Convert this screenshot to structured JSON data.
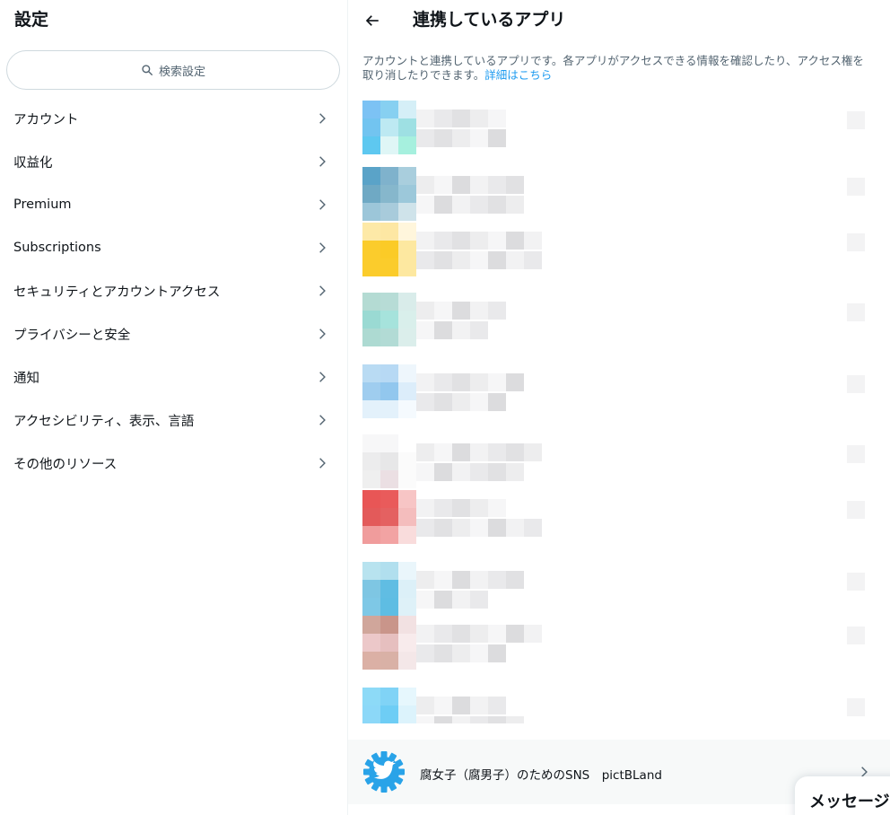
{
  "sidebar": {
    "title": "設定",
    "search_placeholder": "検索設定",
    "items": [
      {
        "label": "アカウント"
      },
      {
        "label": "収益化"
      },
      {
        "label": "Premium"
      },
      {
        "label": "Subscriptions"
      },
      {
        "label": "セキュリティとアカウントアクセス"
      },
      {
        "label": "プライバシーと安全"
      },
      {
        "label": "通知"
      },
      {
        "label": "アクセシビリティ、表示、言語"
      },
      {
        "label": "その他のリソース"
      }
    ]
  },
  "main": {
    "title": "連携しているアプリ",
    "description": "アカウントと連携しているアプリです。各アプリがアクセスできる情報を確認したり、アクセス権を取り消したりできます。",
    "details_link": "詳細はこちら",
    "apps": [
      {
        "name": "",
        "icon_colors": [
          "#7cc2f4",
          "#87d0f1",
          "#d5eff7",
          "#72c4f0",
          "#bde9f2",
          "#9ee0e3",
          "#5ec8f0",
          "#dff6f6",
          "#a6f0de"
        ]
      },
      {
        "name": "",
        "icon_colors": [
          "#5aa3c8",
          "#7fb2cc",
          "#a9cedd",
          "#6fa9c4",
          "#86b7cc",
          "#9cc8da",
          "#9cc6d9",
          "#a8cbdb",
          "#cfe3ea"
        ]
      },
      {
        "name": "",
        "icon_colors": [
          "#fde9a7",
          "#fde7a3",
          "#fff6dc",
          "#fbcc2c",
          "#fbcb27",
          "#fde8a0",
          "#fbcc2c",
          "#fbcc2b",
          "#fde8a0"
        ]
      },
      {
        "name": "",
        "icon_colors": [
          "#b4dbd3",
          "#b7dcd6",
          "#d9ecea",
          "#9adad3",
          "#a6e3dc",
          "#d9efeb",
          "#addad2",
          "#b2dbd5",
          "#dbeeeb"
        ]
      },
      {
        "name": "",
        "icon_colors": [
          "#b9dbf3",
          "#b7d9f4",
          "#eef6fc",
          "#9fcdef",
          "#92c7ee",
          "#dcedfa",
          "#e3f1fb",
          "#e3f1fb",
          "#f5fafe"
        ]
      },
      {
        "name": "",
        "icon_colors": [
          "#f7f7f8",
          "#f7f7f8",
          "#ffffff",
          "#ececed",
          "#e7e7e8",
          "#fbfbfb",
          "#efefef",
          "#ebdfe3",
          "#fbfbfb"
        ]
      },
      {
        "name": "",
        "icon_colors": [
          "#e85656",
          "#e95b5b",
          "#f7c5c5",
          "#e35a5a",
          "#e46161",
          "#f4bdbd",
          "#f09c9c",
          "#f2a3a3",
          "#f9dcdc"
        ]
      },
      {
        "name": "",
        "icon_colors": [
          "#b8e3ef",
          "#b1dfee",
          "#eaf6fb",
          "#7ec6e3",
          "#60bde3",
          "#dcf0f8",
          "#7ec8e6",
          "#5ebde3",
          "#def1f8"
        ]
      },
      {
        "name": "",
        "icon_colors": [
          "#d0a69b",
          "#c9958a",
          "#f2e1e2",
          "#ecc8c9",
          "#e6bfbf",
          "#f8ebec",
          "#dbb0a5",
          "#d9b1a6",
          "#f4e7e8"
        ]
      },
      {
        "name": "",
        "icon_colors": [
          "#8ddaf7",
          "#80d3f6",
          "#e6f7fd",
          "#8cd8f8",
          "#6ecdf5",
          "#dcf3fc",
          "#ffffff",
          "#e3f3fb",
          "#ffffff"
        ]
      }
    ],
    "featured_app": {
      "name": "腐女子（腐男子）のためのSNS　pictBLand"
    }
  },
  "messages_drawer": {
    "label": "メッセージ"
  },
  "colors": {
    "accent": "#1d9bf0",
    "text": "#0f1419",
    "secondary_text": "#536471"
  }
}
